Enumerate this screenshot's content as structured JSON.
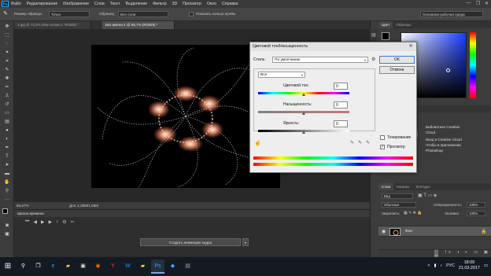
{
  "app": {
    "logo": "Ps",
    "menu": [
      "Файл",
      "Редактирование",
      "Изображение",
      "Слои",
      "Текст",
      "Выделение",
      "Фильтр",
      "3D",
      "Просмотр",
      "Окно",
      "Справка"
    ],
    "window_controls": [
      "—",
      "❐",
      "✕"
    ]
  },
  "options_bar": {
    "sample_size_label": "Размер образца:",
    "sample_size_value": "Точка",
    "sample_label": "Образец:",
    "sample_value": "Все слои",
    "show_ring_label": "Показать кольцо пробы",
    "workspace_value": "Основная рабочая среда"
  },
  "doc_tabs": [
    {
      "label": "3.jpg @ 73,3% (Фон копия 2, RGB/8) *"
    },
    {
      "label": "Без имени-1 @ 66,7% (RGB/8) *"
    }
  ],
  "status": {
    "zoom": "66,67%",
    "doc_info": "Док: 1,29M/1,05M"
  },
  "timeline": {
    "title": "Шкала времени",
    "create_button": "Создать анимацию кадра",
    "dropdown_arrow": "▾"
  },
  "panels": {
    "color_tabs": [
      "Цвет",
      "Образцы"
    ],
    "cc_tabs": [
      "Коррекция",
      "Стили"
    ],
    "cc_lines": [
      "Библиотека Creative",
      "Cloud",
      "Вход в Creative Cloud",
      "Чтобы в приложении",
      "Photoshop"
    ],
    "layers_tabs": [
      "Слои",
      "Каналы",
      "Контуры"
    ],
    "layer_kind": "Вид",
    "blend_mode": "Обычные",
    "opacity_label": "Непрозрачность:",
    "opacity_value": "100%",
    "lock_label": "Закрепить:",
    "fill_label": "Заливка:",
    "fill_value": "100%",
    "layer_name": "Фон"
  },
  "dialog": {
    "title": "Цветовой тон/Насыщенность",
    "close": "✕",
    "style_label": "Стиль:",
    "style_value": "По умолчанию",
    "channel_value": "Все",
    "hue_label": "Цветовой тон:",
    "hue_value": "0",
    "saturation_label": "Насыщенность:",
    "saturation_value": "0",
    "lightness_label": "Яркость:",
    "lightness_value": "0",
    "ok_label": "OK",
    "cancel_label": "Отмена",
    "colorize_label": "Тонирование",
    "colorize_checked": false,
    "preview_label": "Просмотр",
    "preview_checked": true,
    "hue_thumb": 0.5,
    "saturation_thumb": 0.5,
    "lightness_thumb": 0.5
  },
  "taskbar": {
    "start": "⊞",
    "time": "18:09",
    "date": "21.03.2017",
    "lang": "РУС"
  },
  "colors": {
    "accent": "#31a8ff",
    "dialog_bg": "#eeeeee",
    "glow": "#ffb08a"
  }
}
